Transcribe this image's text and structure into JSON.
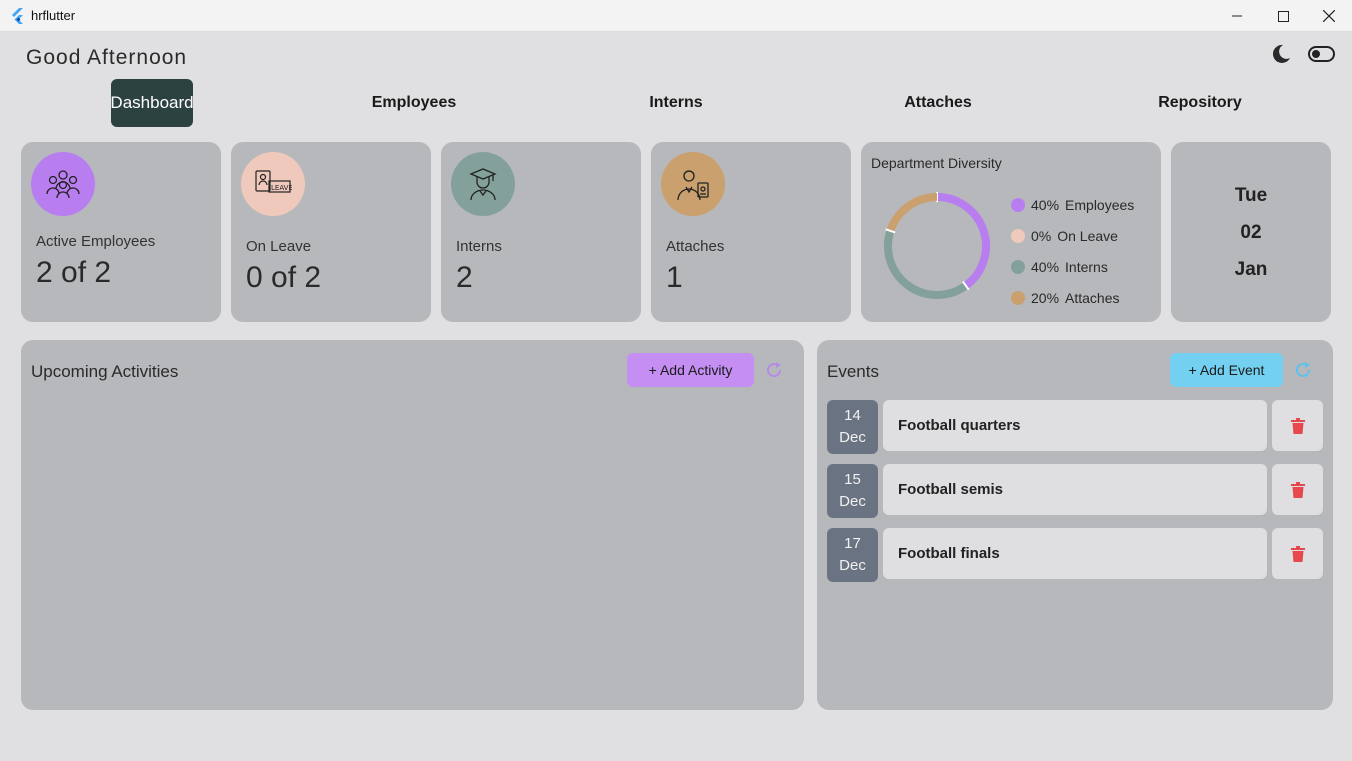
{
  "window": {
    "title": "hrflutter"
  },
  "header": {
    "greeting": "Good Afternoon"
  },
  "nav": {
    "tabs": [
      {
        "label": "Dashboard"
      },
      {
        "label": "Employees"
      },
      {
        "label": "Interns"
      },
      {
        "label": "Attaches"
      },
      {
        "label": "Repository"
      }
    ],
    "active": "Dashboard"
  },
  "stats": [
    {
      "label": "Active Employees",
      "value": "2 of 2",
      "icon": "team-icon",
      "color": "#b87ef0"
    },
    {
      "label": "On Leave",
      "value": "0 of 2",
      "icon": "leave-icon",
      "color": "#f0c9bd"
    },
    {
      "label": "Interns",
      "value": "2",
      "icon": "graduate-icon",
      "color": "#83a19a"
    },
    {
      "label": "Attaches",
      "value": "1",
      "icon": "badge-icon",
      "color": "#c9a06e"
    }
  ],
  "diversity": {
    "title": "Department Diversity",
    "legend": [
      {
        "pct": "40%",
        "label": "Employees",
        "color": "#b87ef0",
        "value": 40
      },
      {
        "pct": "0%",
        "label": "On Leave",
        "color": "#f0c9bd",
        "value": 0
      },
      {
        "pct": "40%",
        "label": "Interns",
        "color": "#83a19a",
        "value": 40
      },
      {
        "pct": "20%",
        "label": "Attaches",
        "color": "#c9a06e",
        "value": 20
      }
    ]
  },
  "date": {
    "weekday": "Tue",
    "day": "02",
    "month": "Jan"
  },
  "activities": {
    "title": "Upcoming Activities",
    "add_label": "+  Add Activity",
    "button_color": "#c48ef3"
  },
  "events": {
    "title": "Events",
    "add_label": "+  Add Event",
    "button_color": "#74d0f1",
    "items": [
      {
        "day": "14",
        "month": "Dec",
        "name": "Football quarters"
      },
      {
        "day": "15",
        "month": "Dec",
        "name": "Football semis"
      },
      {
        "day": "17",
        "month": "Dec",
        "name": "Football finals"
      }
    ]
  }
}
